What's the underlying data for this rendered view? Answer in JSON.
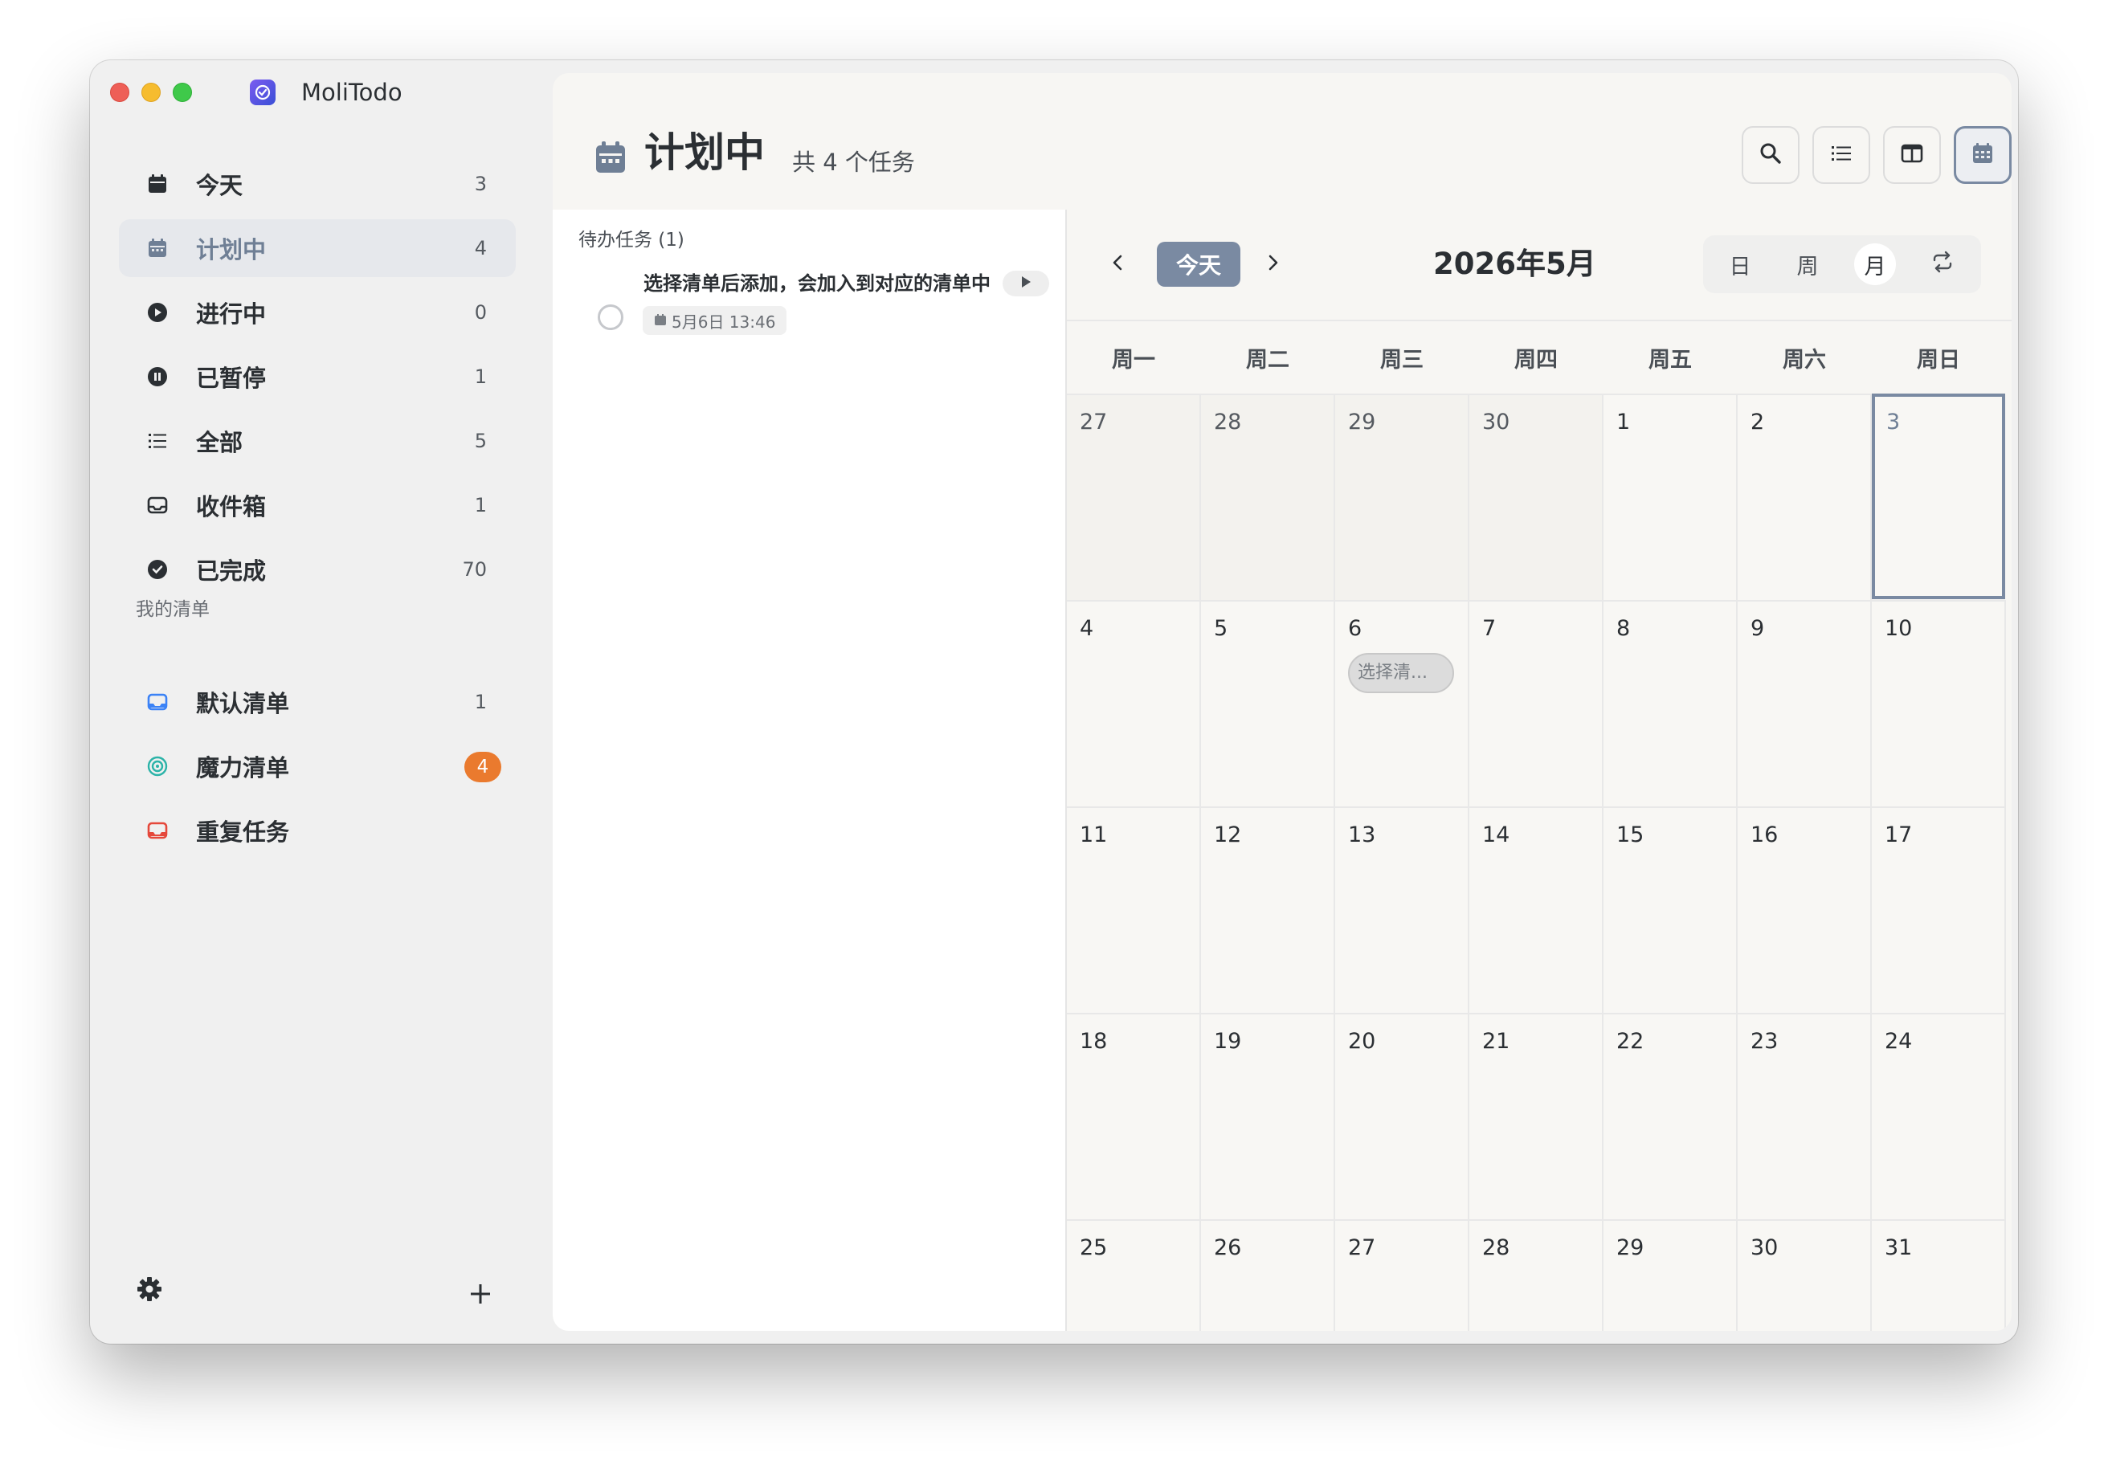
{
  "app": {
    "title": "MoliTodo"
  },
  "sidebar": {
    "items": [
      {
        "label": "今天",
        "count": "3"
      },
      {
        "label": "计划中",
        "count": "4"
      },
      {
        "label": "进行中",
        "count": "0"
      },
      {
        "label": "已暂停",
        "count": "1"
      },
      {
        "label": "全部",
        "count": "5"
      },
      {
        "label": "收件箱",
        "count": "1"
      },
      {
        "label": "已完成",
        "count": "70"
      }
    ],
    "section_title": "我的清单",
    "lists": [
      {
        "label": "默认清单",
        "count": "1",
        "color": "#3b82f6"
      },
      {
        "label": "魔力清单",
        "count": "4",
        "color": "#2bb3a8",
        "badge_color": "#ea7a2e"
      },
      {
        "label": "重复任务",
        "color": "#e5483b"
      }
    ]
  },
  "header": {
    "title": "计划中",
    "subtitle": "共 4 个任务"
  },
  "tasks": {
    "pending_header": "待办任务 (1)",
    "items": [
      {
        "title": "选择清单后添加，会加入到对应的清单中",
        "date": "5月6日 13:46"
      }
    ]
  },
  "calendar": {
    "today_label": "今天",
    "title": "2026年5月",
    "views": [
      "日",
      "周",
      "月"
    ],
    "active_view": "月",
    "weekdays": [
      "周一",
      "周二",
      "周三",
      "周四",
      "周五",
      "周六",
      "周日"
    ],
    "weeks": [
      [
        "27",
        "28",
        "29",
        "30",
        "1",
        "2",
        "3"
      ],
      [
        "4",
        "5",
        "6",
        "7",
        "8",
        "9",
        "10"
      ],
      [
        "11",
        "12",
        "13",
        "14",
        "15",
        "16",
        "17"
      ],
      [
        "18",
        "19",
        "20",
        "21",
        "22",
        "23",
        "24"
      ],
      [
        "25",
        "26",
        "27",
        "28",
        "29",
        "30",
        "31"
      ]
    ],
    "event": {
      "text": "选择清..."
    }
  },
  "colors": {
    "accent": "#7a8aa2",
    "badge": "#ea7a2e"
  }
}
